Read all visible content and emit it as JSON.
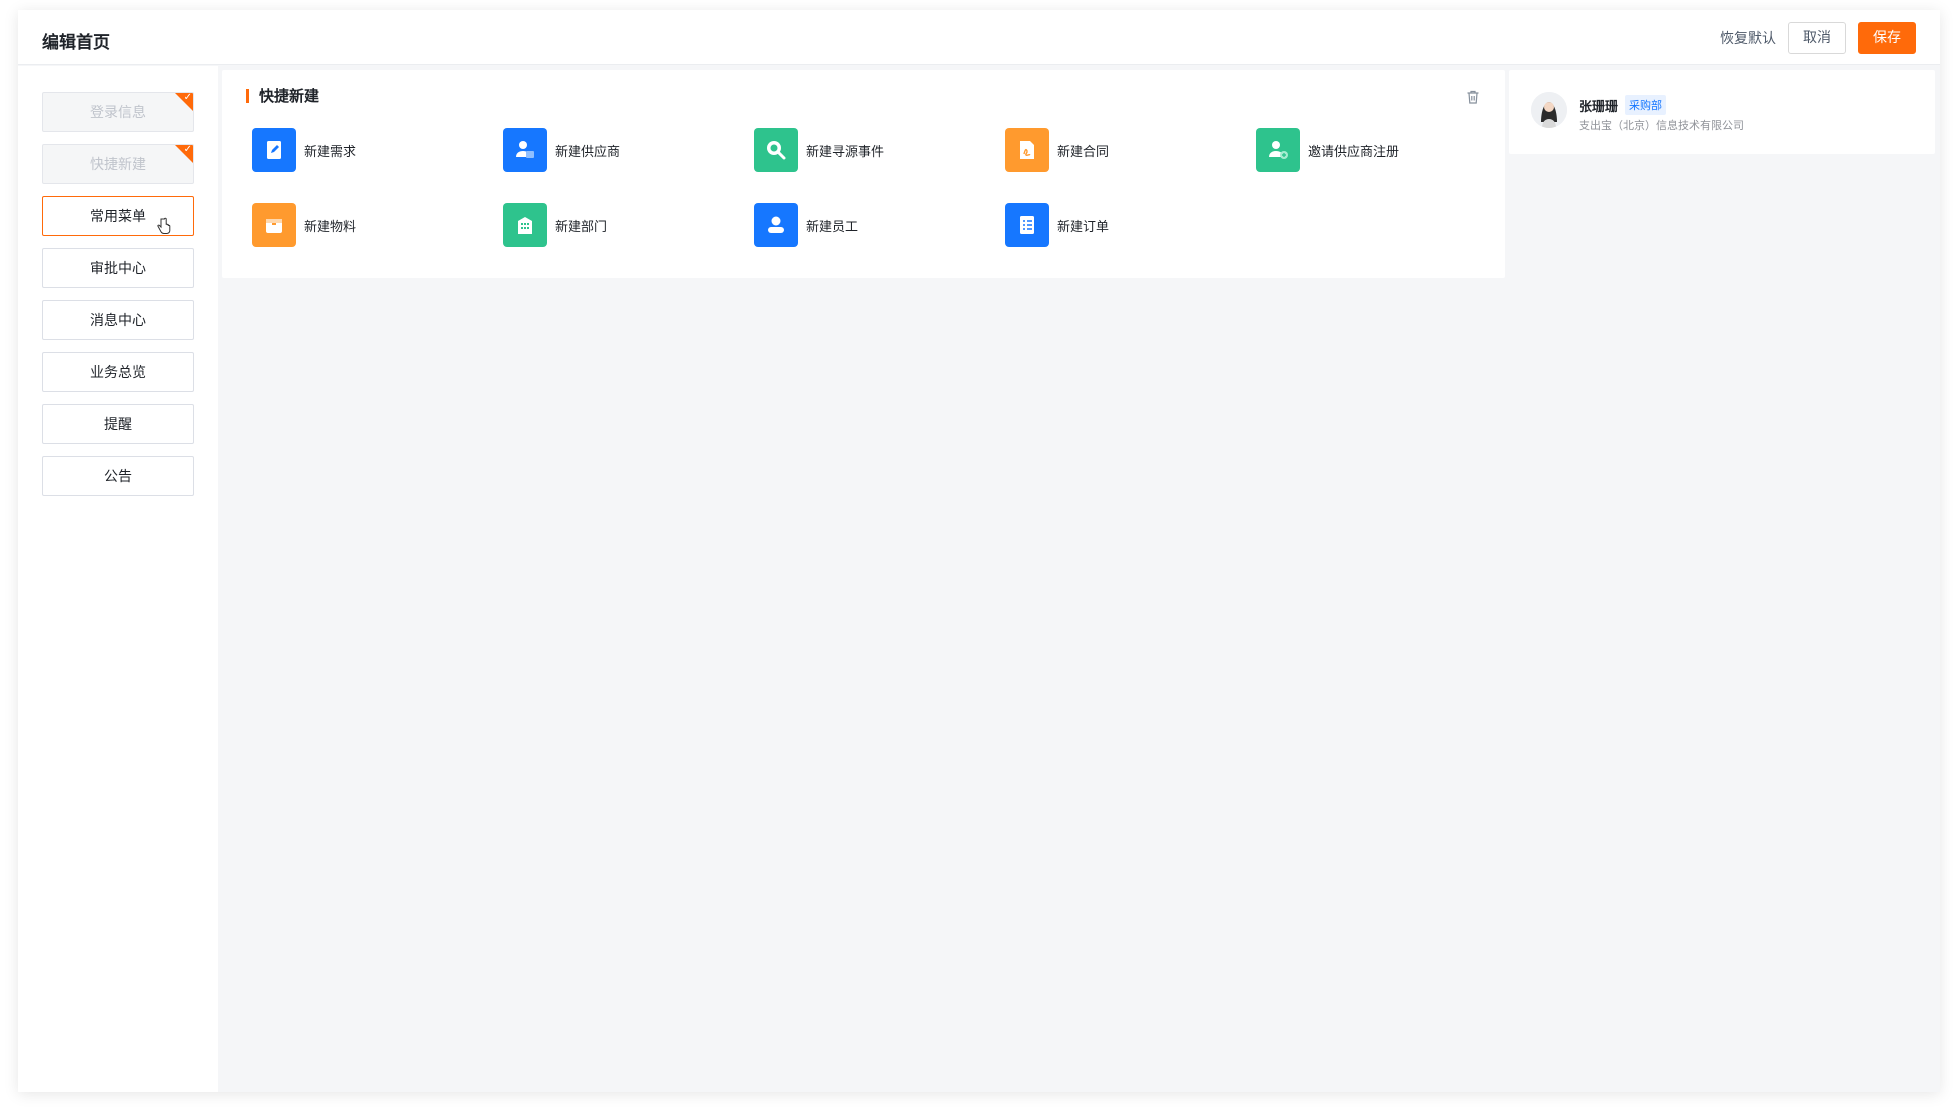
{
  "header": {
    "title": "编辑首页",
    "restore_label": "恢复默认",
    "cancel_label": "取消",
    "save_label": "保存"
  },
  "sidebar": {
    "items": [
      {
        "label": "登录信息",
        "state": "added"
      },
      {
        "label": "快捷新建",
        "state": "added"
      },
      {
        "label": "常用菜单",
        "state": "hover"
      },
      {
        "label": "审批中心",
        "state": "normal"
      },
      {
        "label": "消息中心",
        "state": "normal"
      },
      {
        "label": "业务总览",
        "state": "normal"
      },
      {
        "label": "提醒",
        "state": "normal"
      },
      {
        "label": "公告",
        "state": "normal"
      }
    ]
  },
  "quick_create": {
    "title": "快捷新建",
    "items": [
      {
        "label": "新建需求",
        "icon": "edit-doc-icon",
        "color": "#1677ff"
      },
      {
        "label": "新建供应商",
        "icon": "supplier-icon",
        "color": "#1677ff"
      },
      {
        "label": "新建寻源事件",
        "icon": "search-icon",
        "color": "#2ec38d"
      },
      {
        "label": "新建合同",
        "icon": "contract-icon",
        "color": "#ff9a2e"
      },
      {
        "label": "邀请供应商注册",
        "icon": "invite-user-icon",
        "color": "#2ec38d"
      },
      {
        "label": "新建物料",
        "icon": "box-icon",
        "color": "#ff9a2e"
      },
      {
        "label": "新建部门",
        "icon": "building-icon",
        "color": "#2ec38d"
      },
      {
        "label": "新建员工",
        "icon": "user-icon",
        "color": "#1677ff"
      },
      {
        "label": "新建订单",
        "icon": "order-icon",
        "color": "#1677ff"
      }
    ]
  },
  "profile": {
    "name": "张珊珊",
    "department": "采购部",
    "company": "支出宝（北京）信息技术有限公司"
  },
  "colors": {
    "accent": "#ff6a0a",
    "blue": "#1677ff",
    "green": "#2ec38d",
    "orange": "#ff9a2e"
  }
}
